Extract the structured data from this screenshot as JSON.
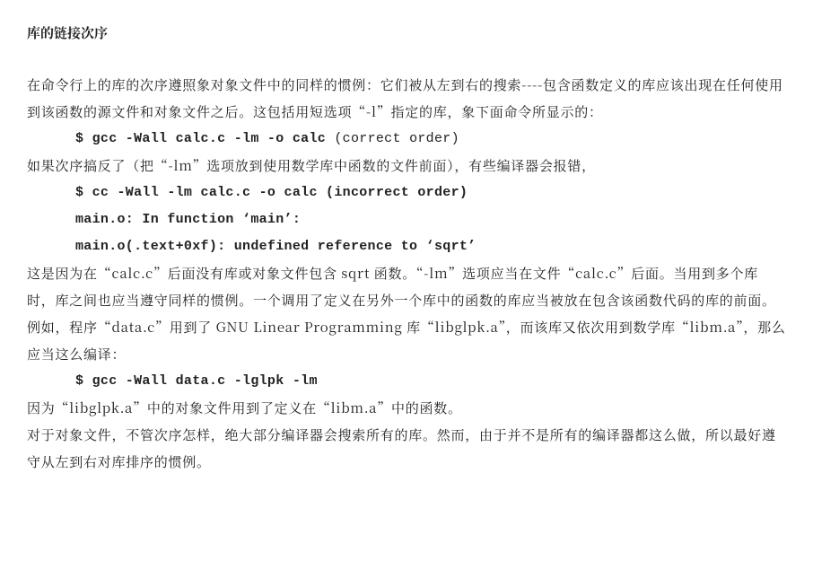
{
  "title": "库的链接次序",
  "p1": "在命令行上的库的次序遵照象对象文件中的同样的惯例：它们被从左到右的搜索----包含函数定义的库应该出现在任何使用到该函数的源文件和对象文件之后。这包括用短选项“-l”指定的库，象下面命令所显示的：",
  "code1_cmd": "$ gcc -Wall calc.c -lm -o calc ",
  "code1_note": "(correct order)",
  "p2": "如果次序搞反了（把“-lm”选项放到使用数学库中函数的文件前面），有些编译器会报错，",
  "code2": "$ cc -Wall -lm calc.c -o calc (incorrect order)",
  "code3": "main.o: In function ‘main’:",
  "code4": "main.o(.text+0xf): undefined reference to ‘sqrt’",
  "p3": "这是因为在“calc.c”后面没有库或对象文件包含 sqrt 函数。“-lm”选项应当在文件“calc.c”后面。当用到多个库时，库之间也应当遵守同样的惯例。一个调用了定义在另外一个库中的函数的库应当被放在包含该函数代码的库的前面。",
  "p4": "例如，程序“data.c”用到了 GNU Linear Programming 库“libglpk.a”，而该库又依次用到数学库“libm.a”，那么应当这么编译：",
  "code5": "$ gcc -Wall data.c -lglpk -lm",
  "p5": "因为“libglpk.a”中的对象文件用到了定义在“libm.a”中的函数。",
  "p6": "对于对象文件，不管次序怎样，绝大部分编译器会搜索所有的库。然而，由于并不是所有的编译器都这么做，所以最好遵守从左到右对库排序的惯例。"
}
